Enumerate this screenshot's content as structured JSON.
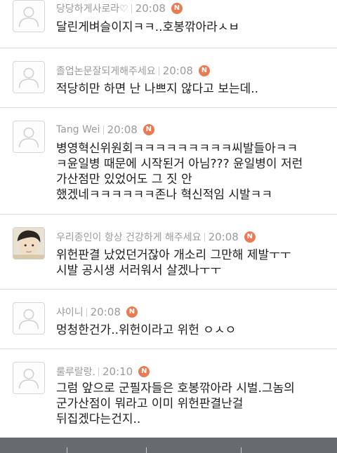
{
  "comments": [
    {
      "nickname": "당당하게사로라♡",
      "time": "20:08",
      "badge": "N",
      "avatar": "default-avatar-icon",
      "text": "달린게벼슬이지ㅋㅋ..호봉깎아라ㅅㅂ"
    },
    {
      "nickname": "졸업논문잘되게해주세요",
      "time": "20:08",
      "badge": "N",
      "avatar": "default-avatar-icon",
      "text": "적당히만 하면 난 나쁘지 않다고 보는데.."
    },
    {
      "nickname": "Tang Wei",
      "time": "20:08",
      "badge": "N",
      "avatar": "default-avatar-icon",
      "text": "병영혁신위원회ㅋㅋㅋㅋㅋㅋㅋㅋㅋ씨발들아ㅋㅋ\nㅋ윤일병 때문에 시작된거 아님??? 윤일병이 저런\n가산점만 있었어도 그 짓 안\n했겠네ㅋㅋㅋㅋㅋㅋ존나 혁신적임 시발ㅋㅋ"
    },
    {
      "nickname": "우리종인이 항상 건강하게 해주세요",
      "time": "20:08",
      "badge": "N",
      "avatar": "photo-avatar",
      "text": "위헌판결 났었던거잖아 개소리 그만해 제발ㅜㅜ\n시발 공시생 서러워서 살겠나ㅜㅜ"
    },
    {
      "nickname": "샤이니",
      "time": "20:08",
      "badge": "N",
      "avatar": "default-avatar-icon",
      "text": "멍청한건가..위헌이라고 위헌 ㅇㅅㅇ"
    },
    {
      "nickname": "룰루랄랑.",
      "time": "20:10",
      "badge": "N",
      "avatar": "default-avatar-icon",
      "text": "그럼 앞으로 군필자들은 호봉깎아라 시벌.그놈의\n군가산점이 뭐라고 이미 위헌판결난걸\n뒤집겠다는건지.."
    }
  ]
}
